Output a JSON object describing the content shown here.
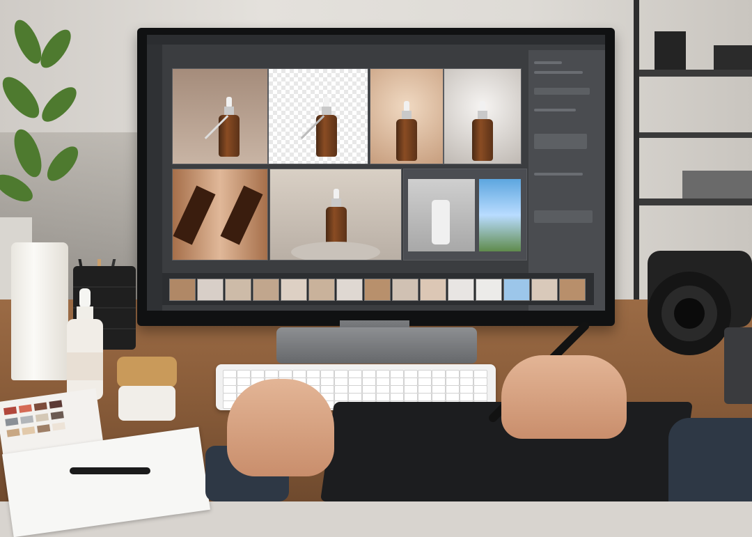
{
  "scene": {
    "description_colors": {
      "wall": "#dedbd6",
      "desk": "#8a5d3a",
      "monitor_bezel": "#101112",
      "editor_bg": "#3b3d40",
      "bottle_amber": "#8a4c23"
    },
    "icons": [
      "plant",
      "pen-holder",
      "lotion-tube",
      "dropper-bottle",
      "cream-jar",
      "color-swatch-card",
      "notebook",
      "pen",
      "monitor",
      "keyboard",
      "drawing-tablet",
      "stylus",
      "camera",
      "mug"
    ]
  },
  "screen": {
    "app": "photo-editor",
    "grid_thumbnails": 8,
    "filmstrip_frames": 15
  }
}
